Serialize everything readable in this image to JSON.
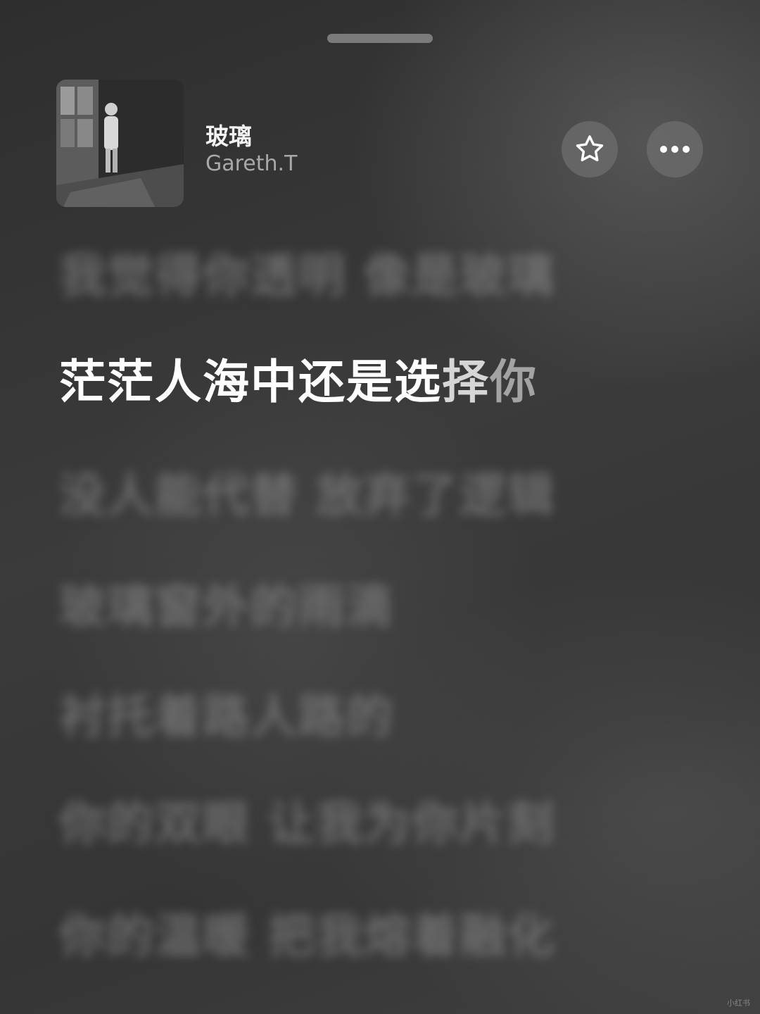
{
  "now_playing": {
    "title": "玻璃",
    "artist": "Gareth.T"
  },
  "actions": {
    "favorite_icon": "star-outline-icon",
    "more_icon": "ellipsis-icon"
  },
  "lyrics": {
    "prev": [
      "我觉得你透明 像是玻璃"
    ],
    "current_main": "茫茫人海中还是选",
    "current_tail_1": "择",
    "current_tail_2": "你",
    "next": [
      "没人能代替 放弃了逻辑",
      "玻璃窗外的雨滴",
      "衬托着路人路的",
      "你的双眼 让我为你片刻",
      "你的温暖 把我熔着融化"
    ]
  },
  "watermark": "小红书"
}
